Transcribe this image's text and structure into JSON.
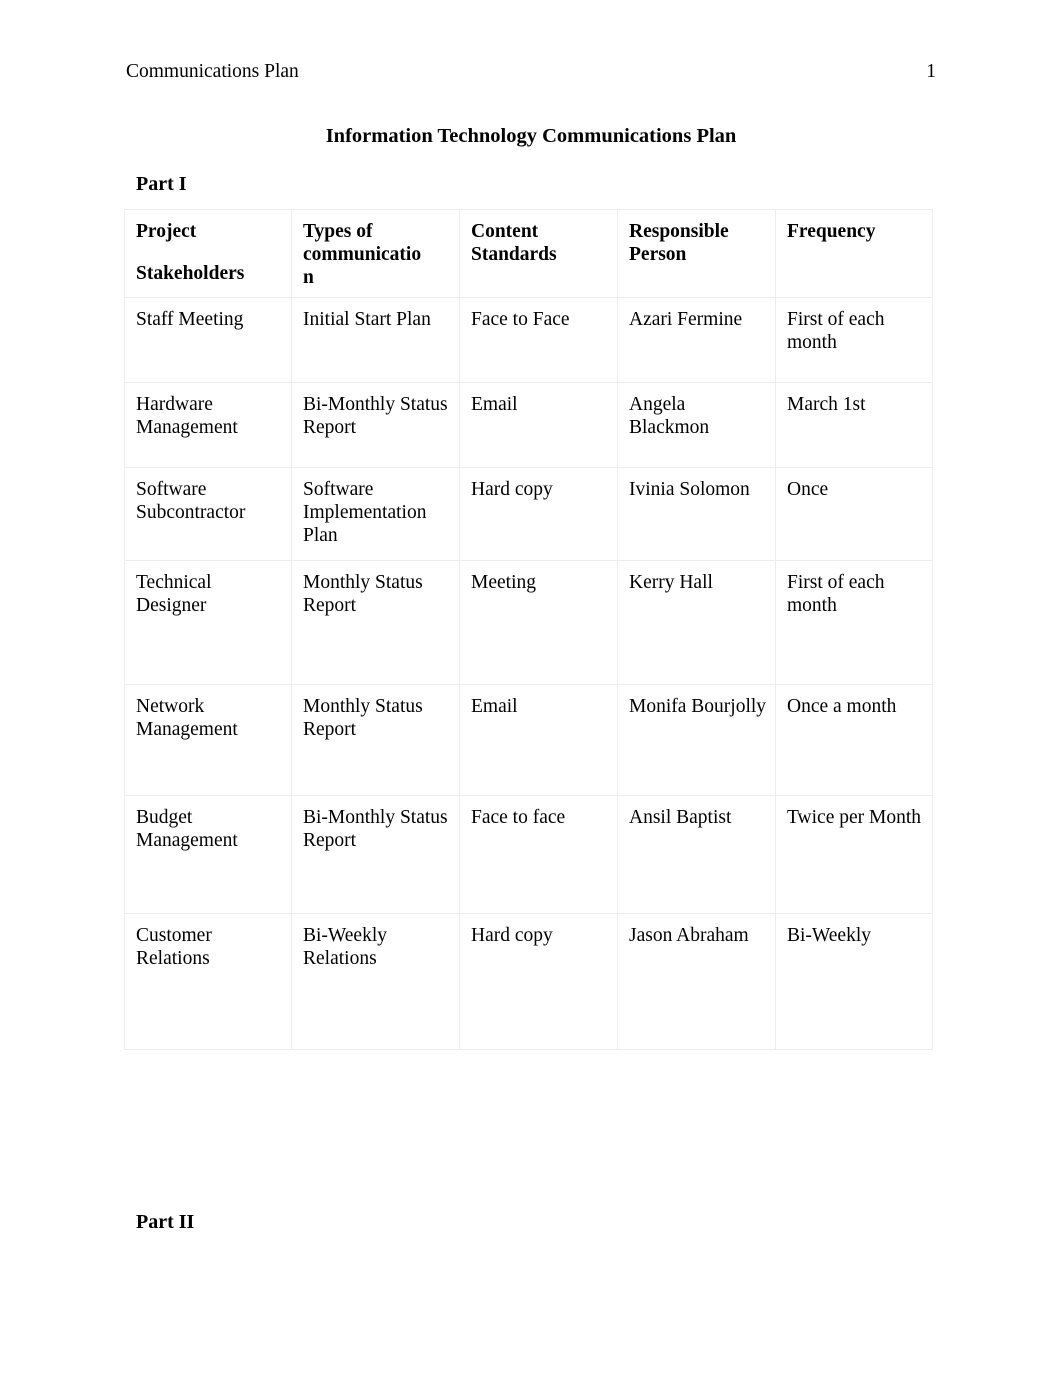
{
  "header": {
    "left_text": "Communications Plan",
    "page_number": "1"
  },
  "title": "Information Technology Communications Plan",
  "sections": {
    "part_one_label": "Part I",
    "part_two_label": "Part II"
  },
  "table": {
    "columns": [
      {
        "line1": "Project",
        "line2": "Stakeholders"
      },
      {
        "line1": "Types of communicatio",
        "line2": "n"
      },
      {
        "line1": "Content Standards",
        "line2": ""
      },
      {
        "line1": "Responsible Person",
        "line2": ""
      },
      {
        "line1": "Frequency",
        "line2": ""
      }
    ],
    "rows": [
      {
        "stakeholder": "Staff Meeting",
        "type": "Initial Start Plan",
        "content_standard": "Face to Face",
        "responsible": "Azari Fermine",
        "frequency": "First of each month"
      },
      {
        "stakeholder": "Hardware Management",
        "type": "Bi-Monthly Status Report",
        "content_standard": "Email",
        "responsible": "Angela Blackmon",
        "frequency": "March 1st"
      },
      {
        "stakeholder": "Software Subcontractor",
        "type": "Software Implementation Plan",
        "content_standard": "Hard copy",
        "responsible": "Ivinia Solomon",
        "frequency": "Once"
      },
      {
        "stakeholder": "Technical Designer",
        "type": "Monthly Status Report",
        "content_standard": "Meeting",
        "responsible": "Kerry Hall",
        "frequency": "First of each month"
      },
      {
        "stakeholder": "Network Management",
        "type": "Monthly Status Report",
        "content_standard": "Email",
        "responsible": "Monifa Bourjolly",
        "frequency": "Once a month"
      },
      {
        "stakeholder": "Budget Management",
        "type": "Bi-Monthly Status Report",
        "content_standard": "Face to face",
        "responsible": "Ansil Baptist",
        "frequency": "Twice per Month"
      },
      {
        "stakeholder": "Customer Relations",
        "type": "Bi-Weekly Relations",
        "content_standard": "Hard copy",
        "responsible": "Jason Abraham",
        "frequency": "Bi-Weekly"
      }
    ]
  },
  "colors": {
    "text": "#000000",
    "table_border": "#ededed",
    "page_background": "#ffffff"
  }
}
